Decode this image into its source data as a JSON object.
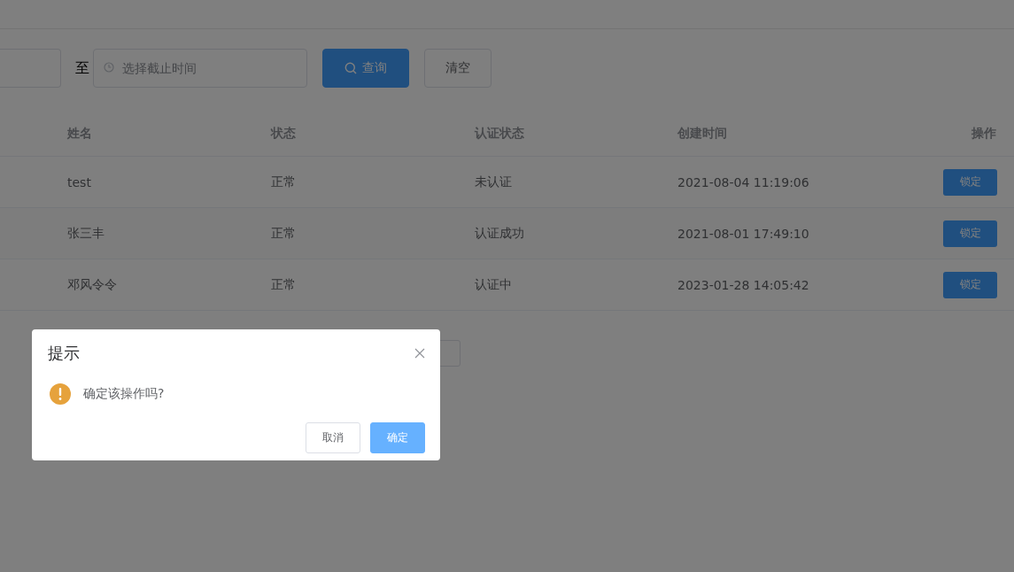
{
  "filter": {
    "range_separator": "至",
    "end_time": {
      "placeholder": "选择截止时间"
    },
    "buttons": [
      {
        "kind": "primary",
        "label": "查询"
      },
      {
        "kind": "default",
        "label": "清空"
      }
    ]
  },
  "table": {
    "columns": [
      "姓名",
      "状态",
      "认证状态",
      "创建时间",
      "操作"
    ],
    "rows": [
      {
        "cells": [
          "test",
          "正常",
          "未认证",
          "2021-08-04 11:19:06"
        ],
        "action": "锁定"
      },
      {
        "cells": [
          "张三丰",
          "正常",
          "认证成功",
          "2021-08-01 17:49:10"
        ],
        "action": "锁定"
      },
      {
        "cells": [
          "邓风令令",
          "正常",
          "认证中",
          "2023-01-28 14:05:42"
        ],
        "action": "锁定"
      }
    ]
  },
  "dialog": {
    "title": "提示",
    "message": "确定该操作吗?",
    "buttons": [
      {
        "kind": "default",
        "label": "取消"
      },
      {
        "kind": "primary",
        "label": "确定"
      }
    ]
  }
}
